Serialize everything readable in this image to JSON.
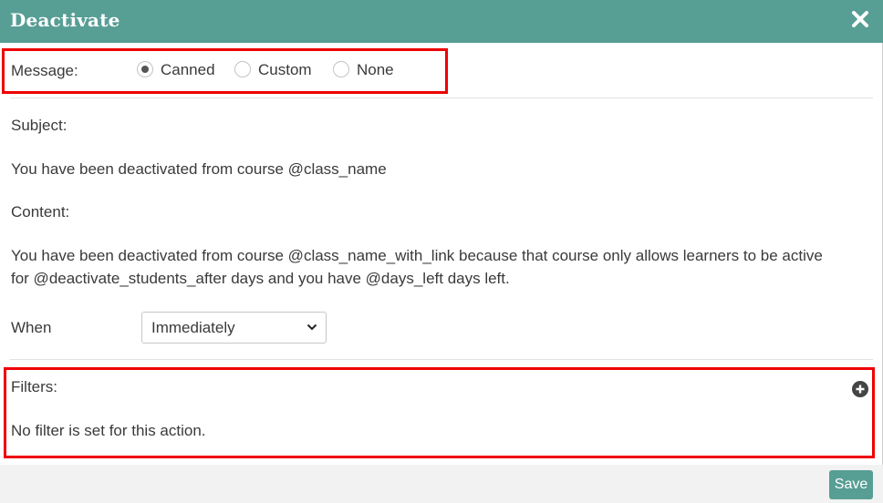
{
  "dialog": {
    "title": "Deactivate",
    "close_icon": "close-icon"
  },
  "message": {
    "label": "Message:",
    "options": [
      {
        "label": "Canned",
        "selected": true
      },
      {
        "label": "Custom",
        "selected": false
      },
      {
        "label": "None",
        "selected": false
      }
    ]
  },
  "subject": {
    "label": "Subject:",
    "value": "You have been deactivated from course @class_name"
  },
  "content": {
    "label": "Content:",
    "line1": "You have been deactivated from course @class_name_with_link because that course only allows learners to be active",
    "line2": "for @deactivate_students_after days and you have @days_left days left."
  },
  "when": {
    "label": "When",
    "selected": "Immediately"
  },
  "filters": {
    "label": "Filters:",
    "empty_text": "No filter is set for this action.",
    "add_icon": "plus-circle-icon"
  },
  "footer": {
    "save_label": "Save"
  },
  "colors": {
    "header": "#579e95",
    "highlight": "#ee0000",
    "save_button": "#579e95"
  }
}
